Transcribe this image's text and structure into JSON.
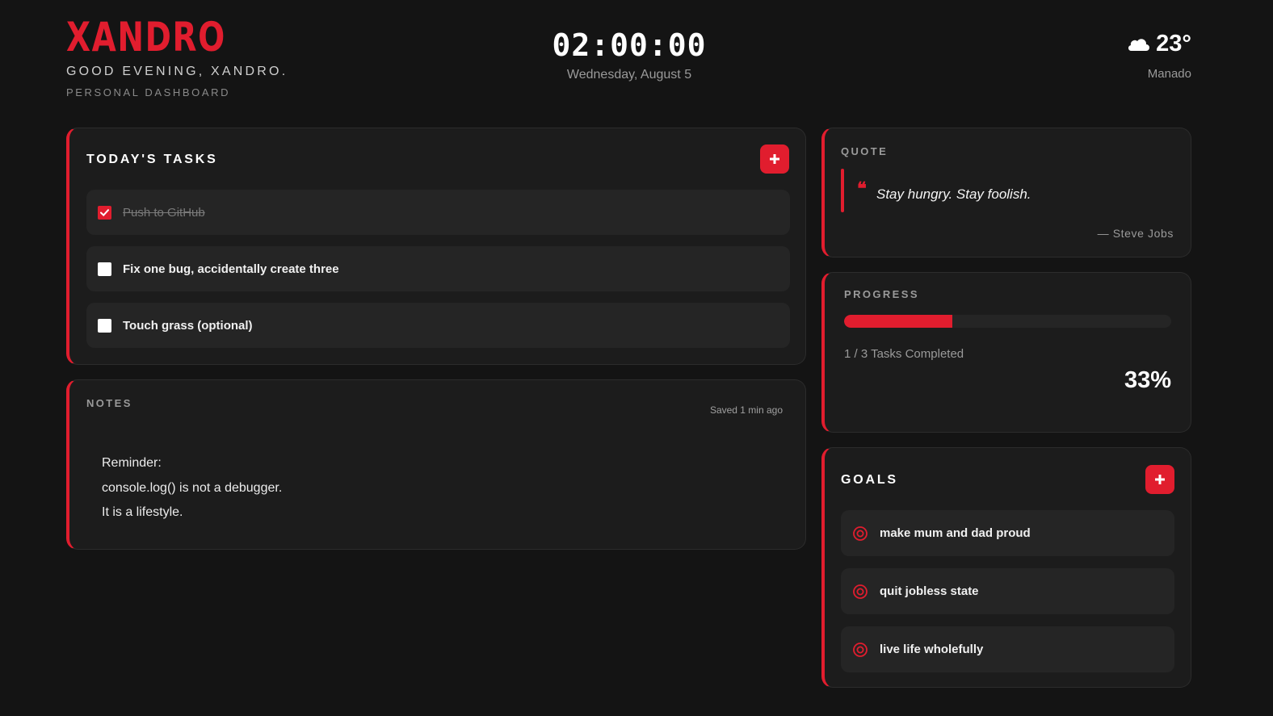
{
  "header": {
    "logo": "XANDRO",
    "greeting": "GOOD EVENING, XANDRO.",
    "subtitle": "PERSONAL DASHBOARD",
    "time": "02:00:00",
    "date": "Wednesday, August 5",
    "weather": {
      "icon": "cloud-icon",
      "temperature": "23°",
      "city": "Manado"
    }
  },
  "tasks": {
    "title": "TODAY'S TASKS",
    "add_icon": "plus-icon",
    "items": [
      {
        "label": "Push to GitHub",
        "done": true
      },
      {
        "label": "Fix one bug, accidentally create three",
        "done": false
      },
      {
        "label": "Touch grass (optional)",
        "done": false
      }
    ]
  },
  "notes": {
    "title": "NOTES",
    "saved_status": "Saved 1 min ago",
    "lines": [
      "Reminder:",
      "console.log() is not a debugger.",
      "It is a lifestyle."
    ]
  },
  "quote": {
    "title": "QUOTE",
    "mark": "❝",
    "text": "Stay hungry. Stay foolish.",
    "author": "— Steve Jobs"
  },
  "progress": {
    "title": "PROGRESS",
    "completed_text": "1 / 3 Tasks Completed",
    "percent_label": "33%",
    "fraction": 0.33
  },
  "goals": {
    "title": "GOALS",
    "add_icon": "plus-icon",
    "items": [
      {
        "label": "make mum and dad proud",
        "icon": "target-icon"
      },
      {
        "label": "quit jobless state",
        "icon": "target-icon"
      },
      {
        "label": "live life wholefully",
        "icon": "target-icon"
      }
    ]
  },
  "colors": {
    "accent": "#e11d2e",
    "background": "#141414",
    "card": "#1c1c1c",
    "item": "#252525"
  }
}
